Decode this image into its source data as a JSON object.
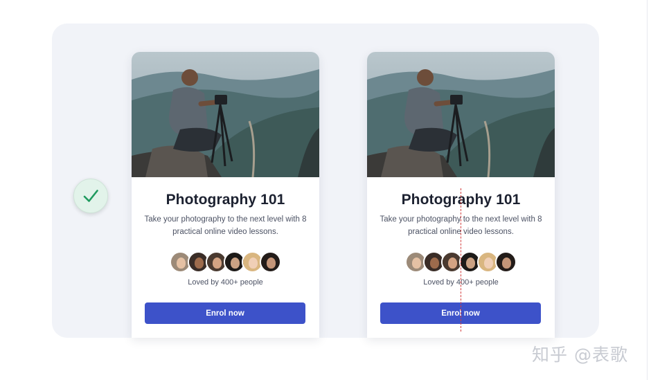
{
  "cards": [
    {
      "title": "Photography 101",
      "description": "Take your photography to the next level with 8 practical online video lessons.",
      "social_proof": "Loved by 400+ people",
      "cta_label": "Enrol now"
    },
    {
      "title": "Photography 101",
      "description": "Take your photography to the next level with 8 practical online video lessons.",
      "social_proof": "Loved by 400+ people",
      "cta_label": "Enrol now"
    }
  ],
  "badge": {
    "icon": "check-icon",
    "color": "#1f9a5e"
  },
  "colors": {
    "button": "#3d52c9",
    "panel": "#f1f3f8",
    "guide": "#d43a3a"
  },
  "watermark": "知乎 @表歌"
}
